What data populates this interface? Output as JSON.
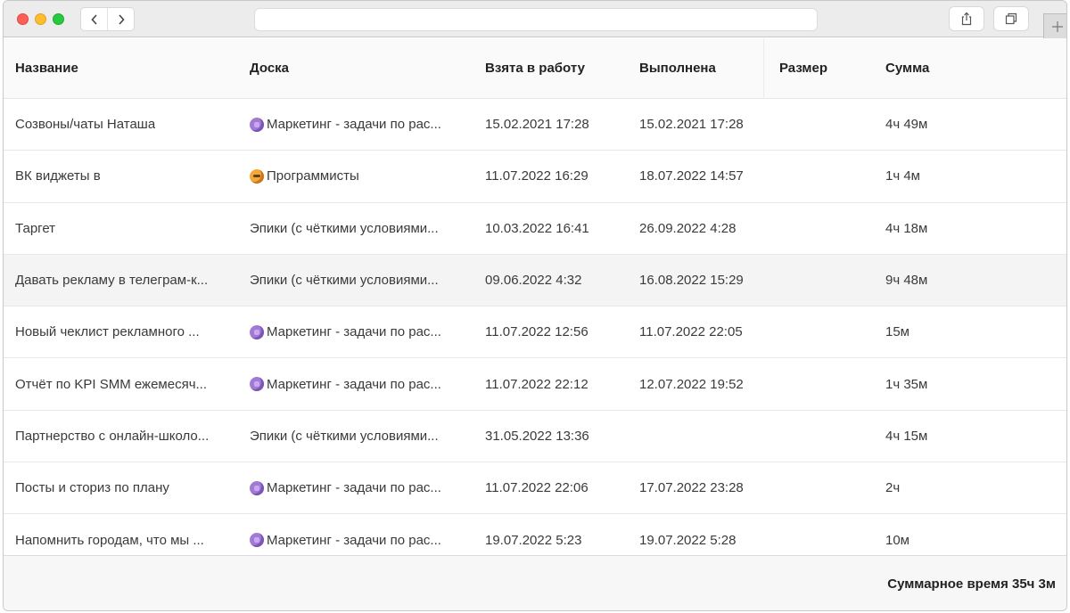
{
  "window": {
    "address": ""
  },
  "table": {
    "columns": [
      "Название",
      "Доска",
      "Взята в работу",
      "Выполнена",
      "Размер",
      "Сумма"
    ],
    "rows": [
      {
        "name": "Созвоны/чаты Наташа",
        "board_icon": "purple-emoji-icon",
        "board": "Маркетинг - задачи по рас...",
        "taken": "15.02.2021 17:28",
        "done": "15.02.2021 17:28",
        "size": "",
        "sum": "4ч 49м"
      },
      {
        "name": "ВК виджеты в",
        "board_icon": "orange-emoji-icon",
        "board": "Программисты",
        "taken": "11.07.2022 16:29",
        "done": "18.07.2022 14:57",
        "size": "",
        "sum": "1ч 4м"
      },
      {
        "name": "Таргет",
        "board_icon": "",
        "board": "Эпики (с чёткими условиями...",
        "taken": "10.03.2022 16:41",
        "done": "26.09.2022 4:28",
        "size": "",
        "sum": "4ч 18м"
      },
      {
        "name": "Давать рекламу в телеграм-к...",
        "board_icon": "",
        "board": "Эпики (с чёткими условиями...",
        "taken": "09.06.2022 4:32",
        "done": "16.08.2022 15:29",
        "size": "",
        "sum": "9ч 48м"
      },
      {
        "name": "Новый чеклист рекламного ...",
        "board_icon": "purple-emoji-icon",
        "board": "Маркетинг - задачи по рас...",
        "taken": "11.07.2022 12:56",
        "done": "11.07.2022 22:05",
        "size": "",
        "sum": "15м"
      },
      {
        "name": "Отчёт по KPI SMM ежемесяч...",
        "board_icon": "purple-emoji-icon",
        "board": "Маркетинг - задачи по рас...",
        "taken": "11.07.2022 22:12",
        "done": "12.07.2022 19:52",
        "size": "",
        "sum": "1ч 35м"
      },
      {
        "name": "Партнерство с онлайн-школо...",
        "board_icon": "",
        "board": "Эпики (с чёткими условиями...",
        "taken": "31.05.2022 13:36",
        "done": "",
        "size": "",
        "sum": "4ч 15м"
      },
      {
        "name": "Посты и сториз по плану",
        "board_icon": "purple-emoji-icon",
        "board": "Маркетинг - задачи по рас...",
        "taken": "11.07.2022 22:06",
        "done": "17.07.2022 23:28",
        "size": "",
        "sum": "2ч"
      },
      {
        "name": "Напомнить городам, что мы ...",
        "board_icon": "purple-emoji-icon",
        "board": "Маркетинг - задачи по рас...",
        "taken": "19.07.2022 5:23",
        "done": "19.07.2022 5:28",
        "size": "",
        "sum": "10м"
      }
    ],
    "highlighted_row": 3
  },
  "footer": {
    "total": "Суммарное время 35ч 3м"
  },
  "colors": {
    "purple_emoji": "#a27ad6",
    "orange_emoji": "#f2a83a",
    "header_bg": "#fafafa",
    "row_highlight": "#f4f4f4"
  }
}
